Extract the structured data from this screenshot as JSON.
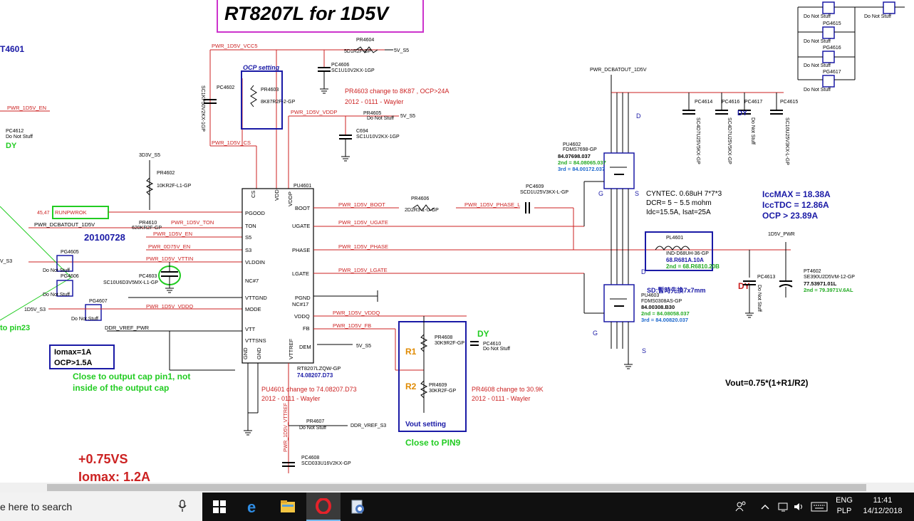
{
  "schematic": {
    "title": "RT8207L for 1D5V",
    "left_clip_label": "T4601",
    "labels": {
      "pwr_1d5v_vcc5": "PWR_1D5V_VCC5",
      "pr4604": "PR4604",
      "pr4604_val": "5D1R2F-GP",
      "five_v_s5": "5V_S5",
      "pc4606": "PC4606",
      "pc4606_val": "SC1U10V2KX-1GP",
      "ocp_setting": "OCP setting",
      "pr4603": "PR4603",
      "pr4603_val": "8K87R2F-2-GP",
      "pc4602": "PC4602",
      "pc4602_val": "SC1KP50V2KX-1GP",
      "pr4603_change": "PR4603 change to 8K87 , OCP>24A",
      "change_date": "2012 - 0111 - Wayler",
      "pwr_1d5v_vddp": "PWR_1D5V_VDDP",
      "pr4605": "PR4605",
      "do_not_stuff": "Do Not Stuff",
      "c694": "C694",
      "c694_val": "SC1U10V2KX-1GP",
      "pwr_1d5v_cs": "PWR_1D5V_CS",
      "pwr_1d5v_en": "PWR_1D5V_EN",
      "pc4612": "PC4612",
      "dy": "DY",
      "three_v3_s5": "3D3V_S5",
      "pr4602": "PR4602",
      "pr4602_val": "10KR2F-L1-GP",
      "net_4547": "45,47",
      "runpwrok": "RUNPWROK",
      "pwr_dcbatout_1d5v": "PWR_DCBATOUT_1D5V",
      "pr4610": "PR4610",
      "pr4610_val": "620KR2F-GP",
      "pwr_1d5v_ton": "PWR_1D5V_TON",
      "date_20100728": "20100728",
      "pwr_1d5v_en_s5": "PWR_1D5V_EN",
      "pwr_0d75v_en": "PWR_0D75V_EN",
      "pwr_1d5v_vttin": "PWR_1D5V_VTTIN",
      "v_s3": "V_S3",
      "pg4605": "PG4605",
      "pg4606": "PG4606",
      "pc4603": "PC4603",
      "pc4603_val": "SC10U6D3V5MX-L1-GP",
      "pg4607": "PG4607",
      "one_d5v_s3": "1D5V_S3",
      "pwr_1d5v_vddq_l": "PWR_1D5V_VDDQ",
      "to_pin23": "to pin23",
      "ddr_vref_pwr": "DDR_VREF_PWR",
      "iomax1": "Iomax=1A",
      "ocp15": "OCP>1.5A",
      "close_to_cap1": "Close to output cap pin1, not",
      "close_to_cap2": "inside of the output cap",
      "plus075vs": "+0.75VS",
      "iomax12": "Iomax: 1.2A",
      "pu4601": "PU4601",
      "pu4601_part": "RT8207LZQW-GP",
      "pu4601_num": "74.08207.D73",
      "pu4601_change": "PU4601 change to  74.08207.D73",
      "pr4607": "PR4607",
      "ddr_vref_s3": "DDR_VREF_S3",
      "pwr_1d5v_vttref": "PWR_1D5V_VTTREF",
      "pc4608": "PC4608",
      "pc4608_val": "SCD033U16V2KX-GP",
      "pwr_1d5v_boot": "PWR_1D5V_BOOT",
      "pr4606": "PR4606",
      "pr4606_val": "2D2R3-1-U-GP",
      "pwr_1d5v_phase_l": "PWR_1D5V_PHASE_L",
      "pc4609": "PC4609",
      "pc4609_val": "SCD1U25V3KX-L-GP",
      "pwr_1d5v_ugate": "PWR_1D5V_UGATE",
      "pwr_1d5v_phase": "PWR_1D5V_PHASE",
      "pwr_1d5v_lgate": "PWR_1D5V_LGATE",
      "pwr_1d5v_vddq": "PWR_1D5V_VDDQ",
      "pwr_1d5v_fb": "PWR_1D5V_FB",
      "r1": "R1",
      "r2": "R2",
      "pr4608": "PR4608",
      "pr4608_val": "30K9R2F-GP",
      "pr4609": "PR4609",
      "pr4609_val": "30KR2F-GP",
      "vout_setting": "Vout setting",
      "close_to_pin9": "Close to PIN9",
      "pc4610": "PC4610",
      "pr4608_change": "PR4608 change to  30.9K",
      "pwr_dcbatout_1d5v_top": "PWR_DCBATOUT_1D5V",
      "pc4614": "PC4614",
      "pc4616": "PC4616",
      "pc4617": "PC4617",
      "pc4615": "PC4615",
      "cap_val_a": "SC4D7U25V5KX-GP",
      "cap_val_b": "SC10U25V3KX-L-GP",
      "pu4602": "PU4602",
      "pu4602_part": "FDMS7698-GP",
      "pu4602_num": "84.07698.037",
      "pu4602_2nd": "2nd = 84.08065.037",
      "pu4602_3rd": "3rd = 84.00172.037",
      "pu4603": "PU4603",
      "pu4603_part": "FDMS0308AS-GP",
      "pu4603_num": "84.00308.B30",
      "pu4603_2nd": "2nd = 84.08058.037",
      "pu4603_3rd": "3rd = 84.00820.037",
      "sd_text": "SD:暫時先換7x7mm",
      "cyntec1": "CYNTEC. 0.68uH 7*7*3",
      "cyntec2": "DCR= 5 ~ 5.5 mohm",
      "cyntec3": "Idc=15.5A, Isat=25A",
      "iccmax": "IccMAX = 18.38A",
      "icctdc": "IccTDC = 12.86A",
      "ocp_2389": "OCP > 23.89A",
      "one_d5v_pwr": "1D5V_PWR",
      "pl4601": "PL4601",
      "pl4601_val": "IND-D68UH-36-GP",
      "pl4601_num": "68.R681A.10A",
      "pl4601_2nd": "2nd = 68.R6810.20B",
      "pc4613": "PC4613",
      "pt4602": "PT4602",
      "pt4602_val": "SE390U2D5VM-12-GP",
      "pt4602_num": "77.53971.01L",
      "pt4602_2nd": "2nd = 79.3971V.6AL",
      "vout_formula": "Vout=0.75*(1+R1/R2)",
      "pg4615": "PG4615",
      "pg4616": "PG4616",
      "pg4617": "PG4617",
      "pin_pgood": "PGOOD",
      "pin_ton": "TON",
      "pin_s5": "S5",
      "pin_s3": "S3",
      "pin_vldoin": "VLDOIN",
      "pin_nc7": "NC#7",
      "pin_vttgnd": "VTTGND",
      "pin_mode": "MODE",
      "pin_vtt": "VTT",
      "pin_vttsns": "VTTSNS",
      "pin_gnd": "GND",
      "pin_cs": "CS",
      "pin_vdd": "VDD",
      "pin_vddp": "VDDP",
      "pin_boot": "BOOT",
      "pin_ugate": "UGATE",
      "pin_phase": "PHASE",
      "pin_lgate": "LGATE",
      "pin_pgnd": "PGND",
      "pin_nc17": "NC#17",
      "pin_vddq": "VDDQ",
      "pin_fb": "FB",
      "pin_dem": "DEM",
      "pin_vttref": "VTTREF",
      "g": "G",
      "s": "S",
      "d": "D"
    }
  },
  "taskbar": {
    "search_placeholder": "e here to search",
    "icons": [
      "start-windows-icon",
      "edge-browser-icon",
      "file-explorer-icon",
      "opera-browser-icon",
      "document-viewer-icon"
    ],
    "lang1": "ENG",
    "lang2": "PLP",
    "time": "11:41",
    "date": "14/12/2018"
  },
  "colors": {
    "title_border": "#cc33cc",
    "net_red": "#cc2222",
    "blue": "#1a1aa6",
    "green": "#22cc22",
    "taskbar": "#101010"
  }
}
